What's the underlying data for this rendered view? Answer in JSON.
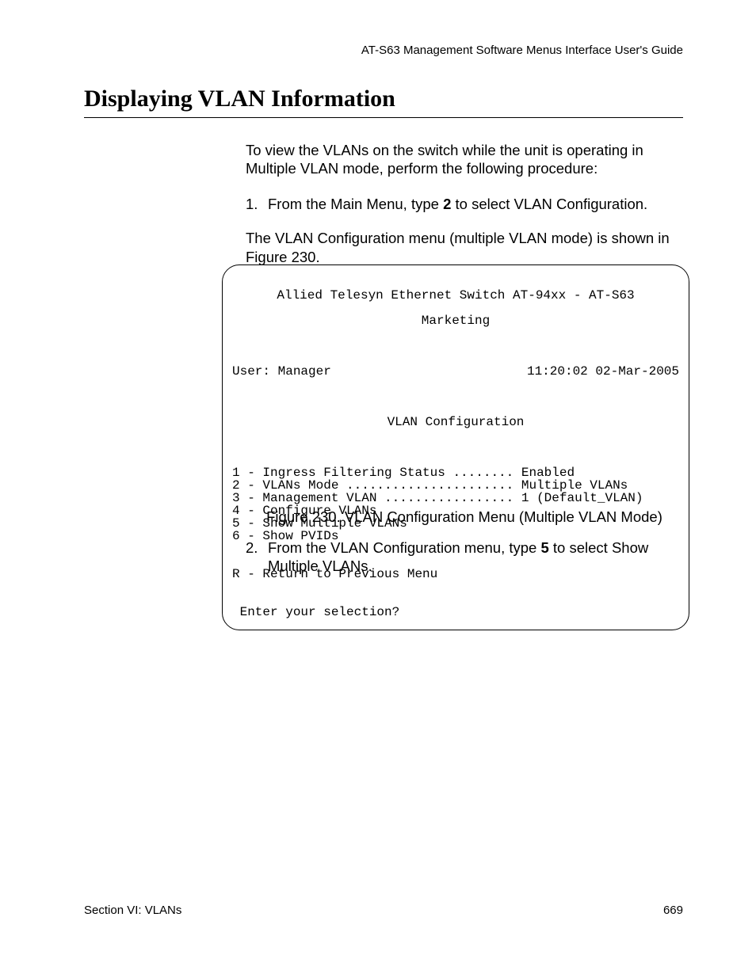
{
  "header": {
    "running": "AT-S63 Management Software Menus Interface User's Guide"
  },
  "title": "Displaying VLAN Information",
  "intro": "To view the VLANs on the switch while the unit is operating in Multiple VLAN mode, perform the following procedure:",
  "step1": {
    "num": "1.",
    "pre": "From the Main Menu, type ",
    "bold": "2",
    "post": " to select VLAN Configuration.",
    "sub": "The VLAN Configuration menu (multiple VLAN mode) is shown in Figure 230."
  },
  "terminal": {
    "line1": "Allied Telesyn Ethernet Switch AT-94xx - AT-S63",
    "line2": "Marketing",
    "user_left": "User: Manager",
    "user_right": "11:20:02 02-Mar-2005",
    "menu_title": "VLAN Configuration",
    "opt1": "1 - Ingress Filtering Status ........ Enabled",
    "opt2": "2 - VLANs Mode ...................... Multiple VLANs",
    "opt3": "3 - Management VLAN ................. 1 (Default_VLAN)",
    "opt4": "4 - Configure VLANs",
    "opt5": "5 - Show Multiple VLANs",
    "opt6": "6 - Show PVIDs",
    "optR": "R - Return to Previous Menu",
    "prompt": " Enter your selection?"
  },
  "caption": "Figure 230. VLAN Configuration Menu (Multiple VLAN Mode)",
  "step2": {
    "num": "2.",
    "pre": "From the VLAN Configuration menu, type ",
    "bold": "5",
    "post": " to select Show Multiple VLANs."
  },
  "footer": {
    "left": "Section VI: VLANs",
    "right": "669"
  }
}
